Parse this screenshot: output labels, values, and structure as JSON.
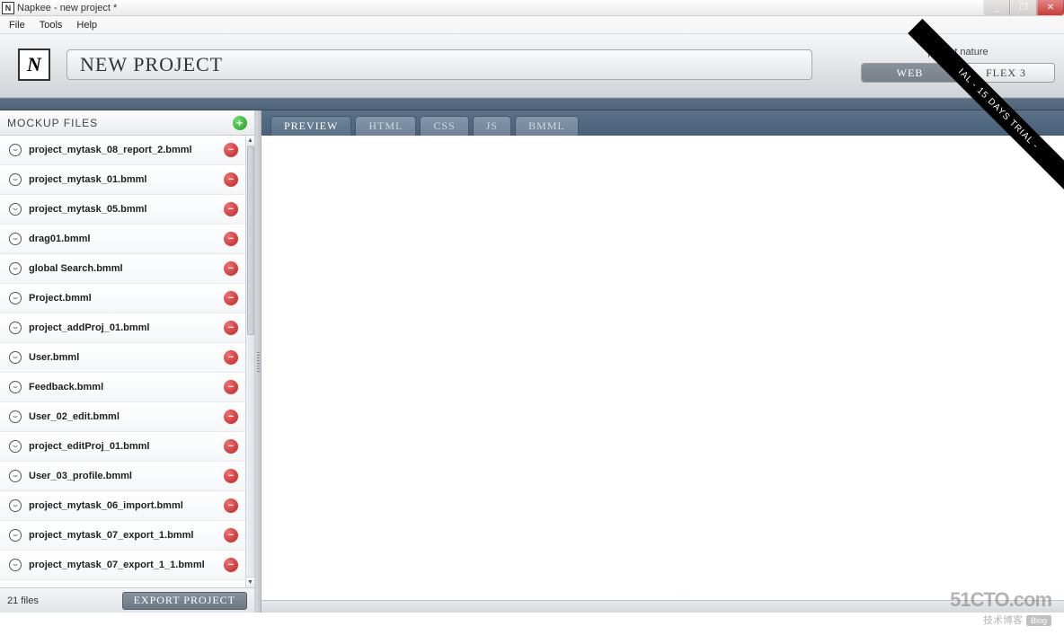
{
  "window": {
    "title": "Napkee - new project *",
    "menus": [
      "File",
      "Tools",
      "Help"
    ],
    "buttons": {
      "min": "_",
      "max": "❐",
      "close": "✕"
    }
  },
  "header": {
    "logo_letter": "N",
    "project_title": "NEW PROJECT",
    "nature_label": "project nature",
    "nature_tabs": [
      {
        "label": "WEB",
        "active": true
      },
      {
        "label": "FLEX 3",
        "active": false
      }
    ]
  },
  "sidebar": {
    "heading": "MOCKUP FILES",
    "add_symbol": "+",
    "files": [
      "project_mytask_08_report_2.bmml",
      "project_mytask_01.bmml",
      "project_mytask_05.bmml",
      "drag01.bmml",
      "global Search.bmml",
      "Project.bmml",
      "project_addProj_01.bmml",
      "User.bmml",
      "Feedback.bmml",
      "User_02_edit.bmml",
      "project_editProj_01.bmml",
      "User_03_profile.bmml",
      "project_mytask_06_import.bmml",
      "project_mytask_07_export_1.bmml",
      "project_mytask_07_export_1_1.bmml"
    ],
    "remove_symbol": "−",
    "smiley": "☺",
    "footer_count": "21 files",
    "export_button": "EXPORT PROJECT"
  },
  "tabs": [
    {
      "label": "PREVIEW",
      "active": true
    },
    {
      "label": "HTML",
      "active": false
    },
    {
      "label": "CSS",
      "active": false
    },
    {
      "label": "JS",
      "active": false
    },
    {
      "label": "BMML",
      "active": false
    }
  ],
  "trial_ribbon": "IAL - 15 DAYS TRIAL -",
  "watermark": {
    "line1": "51CTO.com",
    "line2": "技术博客",
    "badge": "Blog"
  }
}
